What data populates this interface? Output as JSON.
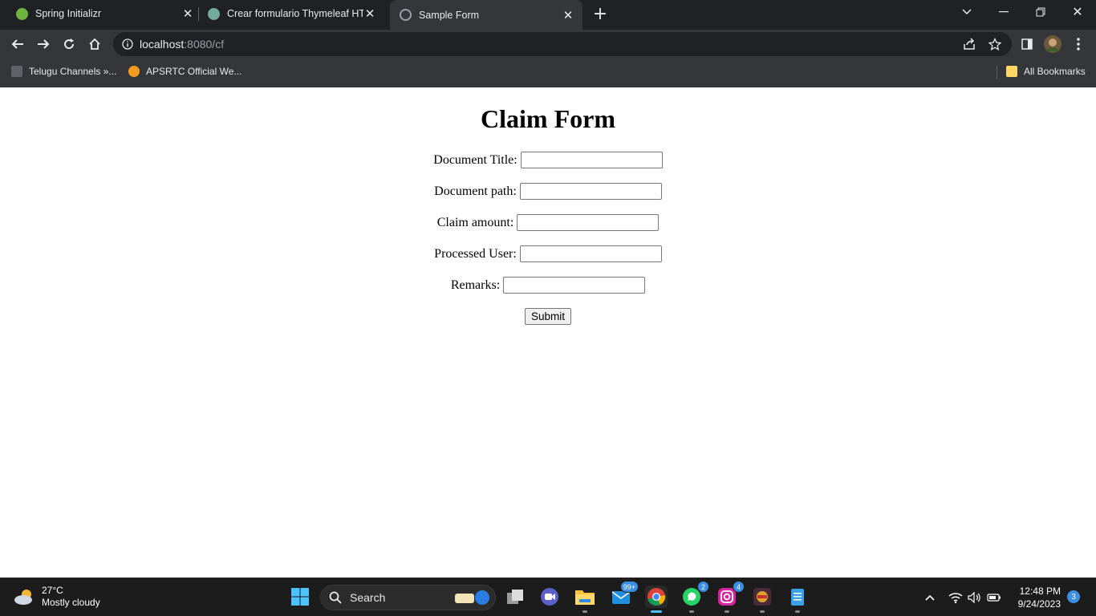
{
  "browser": {
    "tabs": [
      {
        "title": "Spring Initializr",
        "icon": "spring-leaf-icon"
      },
      {
        "title": "Crear formulario Thymeleaf HTML",
        "icon": "chatgpt-icon"
      },
      {
        "title": "Sample Form",
        "icon": "globe-icon"
      }
    ],
    "active_tab": 2,
    "url_host": "localhost",
    "url_rest": ":8080/cf",
    "bookmarks": [
      {
        "label": "Telugu Channels »...",
        "icon": "tv-icon"
      },
      {
        "label": "APSRTC Official We...",
        "icon": "apsrtc-logo-icon"
      }
    ],
    "all_bookmarks_label": "All Bookmarks"
  },
  "form": {
    "heading": "Claim Form",
    "fields": [
      {
        "label": "Document Title:",
        "value": ""
      },
      {
        "label": "Document path:",
        "value": ""
      },
      {
        "label": "Claim amount:",
        "value": ""
      },
      {
        "label": "Processed User:",
        "value": ""
      },
      {
        "label": "Remarks:",
        "value": ""
      }
    ],
    "submit_label": "Submit"
  },
  "taskbar": {
    "weather_temp": "27°C",
    "weather_desc": "Mostly cloudy",
    "search_label": "Search",
    "mail_badge": "99+",
    "whatsapp_badge": "2",
    "instagram_badge": "4",
    "time": "12:48 PM",
    "date": "9/24/2023",
    "notification_count": "3"
  },
  "colors": {
    "tab_strip": "#202124",
    "toolbar": "#35363a",
    "taskbar": "#1c1c1c",
    "accent_badge": "#3b8ee6"
  }
}
